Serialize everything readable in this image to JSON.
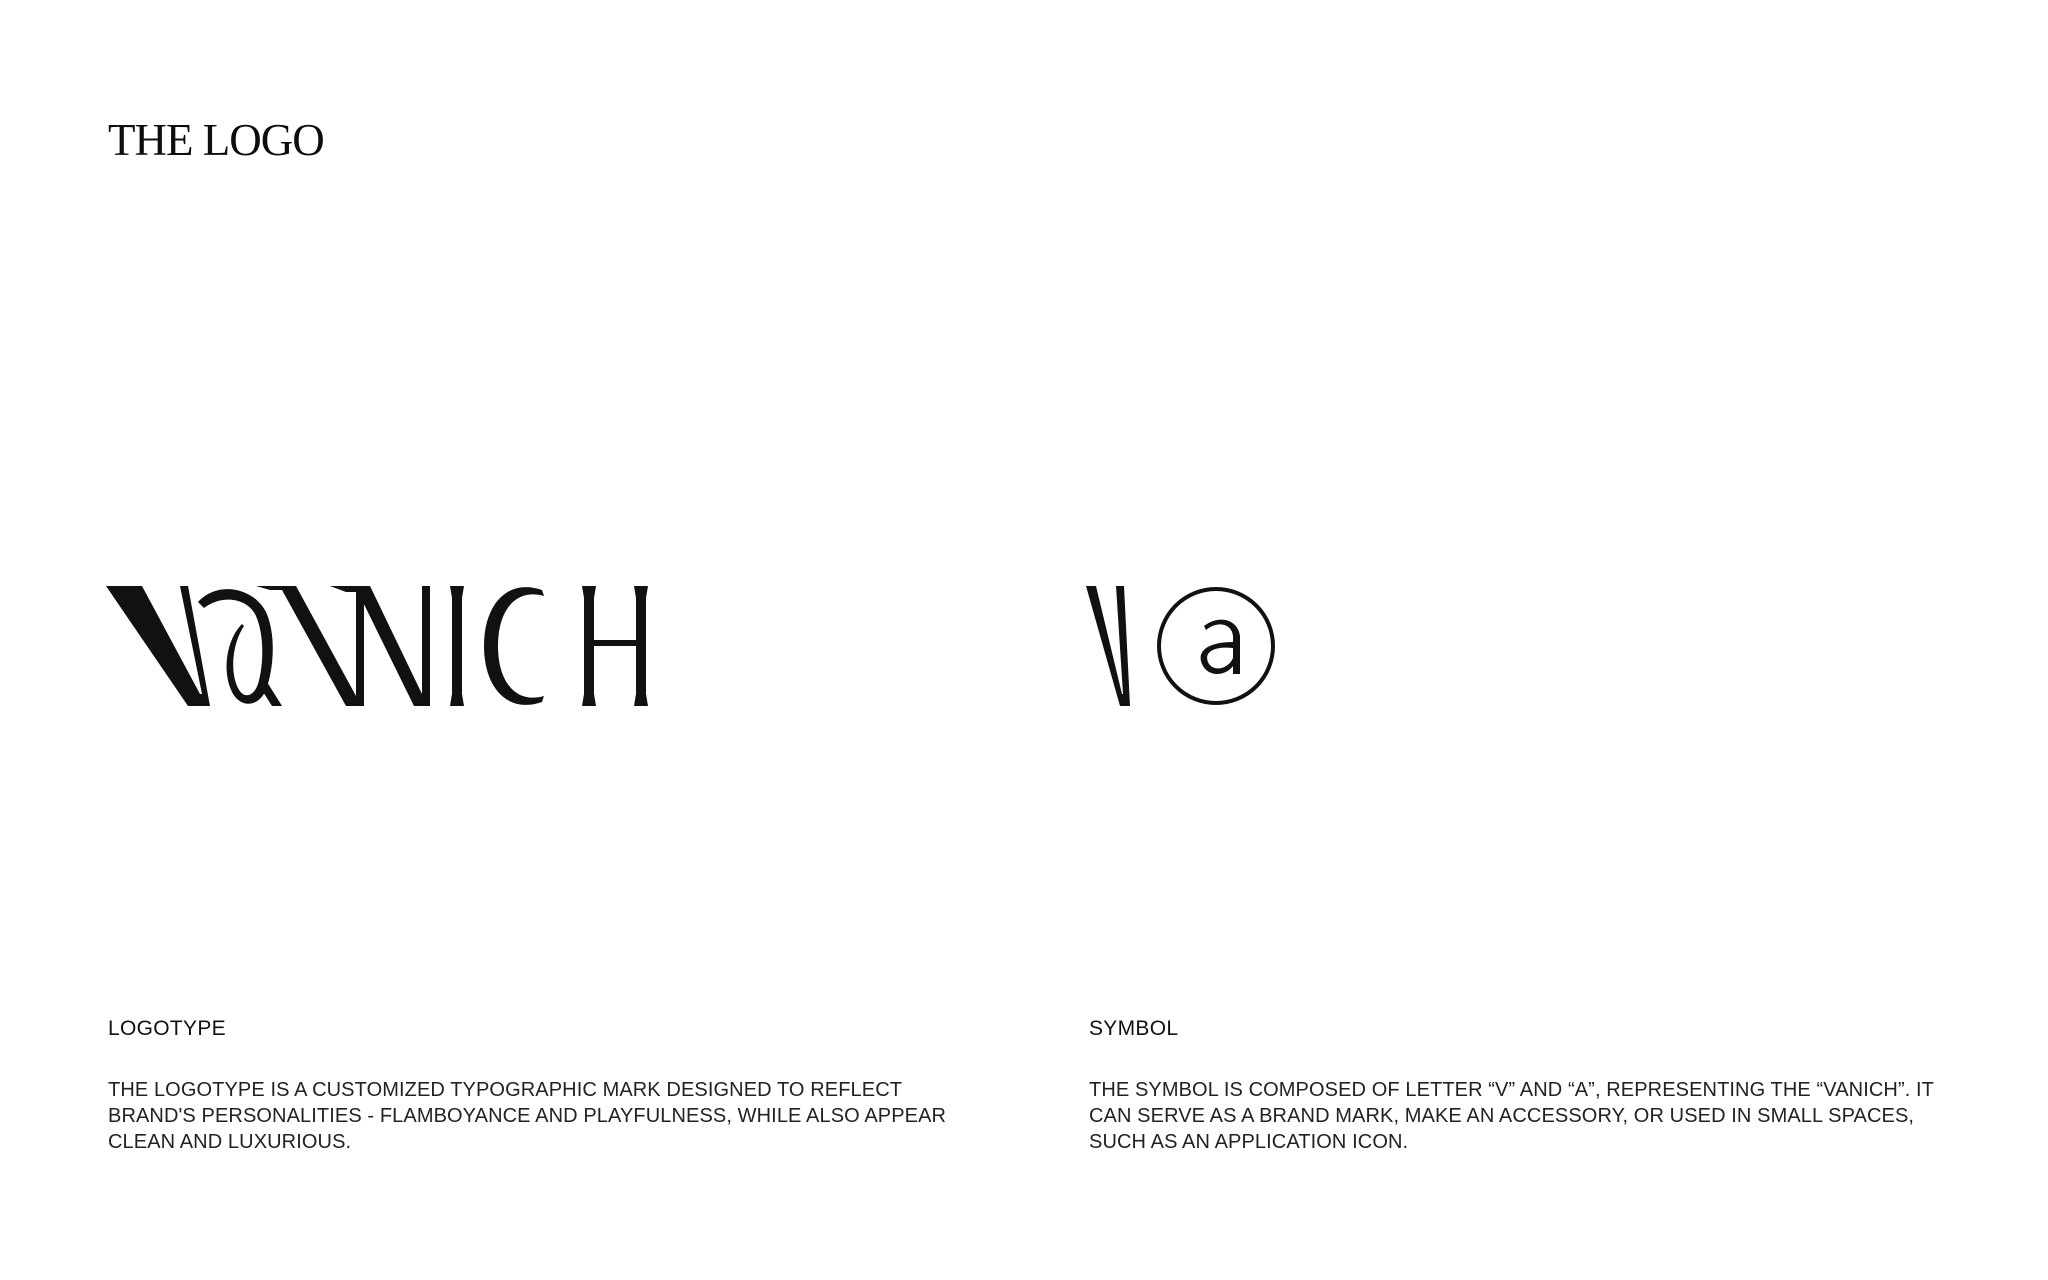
{
  "page": {
    "title": "THE LOGO"
  },
  "logotype": {
    "wordmark": "VANICH",
    "heading": "LOGOTYPE",
    "description": "THE LOGOTYPE IS A CUSTOMIZED TYPOGRAPHIC MARK DESIGNED TO REFLECT BRAND'S PERSONALITIES - FLAMBOYANCE AND PLAYFULNESS, WHILE ALSO APPEAR CLEAN AND LUXURIOUS."
  },
  "symbol": {
    "glyphs": "Va",
    "heading": "SYMBOL",
    "description": "THE SYMBOL IS COMPOSED OF LETTER “V” AND “a”, REPRESENTING THE “VANICH”. IT CAN SERVE AS A BRAND MARK, MAKE AN ACCESSORY, OR USED IN SMALL SPACES, SUCH AS AN APPLICATION ICON."
  },
  "colors": {
    "background": "#ffffff",
    "ink": "#111111"
  }
}
